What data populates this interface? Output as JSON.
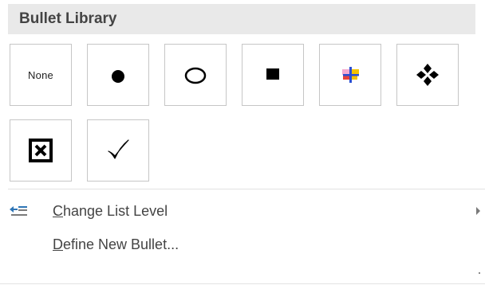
{
  "bullet_library": {
    "header": "Bullet Library",
    "tiles": [
      {
        "kind": "none",
        "label": "None"
      },
      {
        "kind": "filled-circle",
        "icon": "filled-circle-bullet-icon"
      },
      {
        "kind": "hollow-circle",
        "icon": "hollow-circle-bullet-icon"
      },
      {
        "kind": "filled-square",
        "icon": "filled-square-bullet-icon"
      },
      {
        "kind": "colored-cross",
        "icon": "colored-cross-bullet-icon",
        "colors": [
          "#e8423c",
          "#f5a9d0",
          "#f2c200",
          "#2a4fd4"
        ]
      },
      {
        "kind": "four-diamonds",
        "icon": "four-diamonds-bullet-icon"
      },
      {
        "kind": "x-box",
        "icon": "x-box-bullet-icon"
      },
      {
        "kind": "checkmark",
        "icon": "checkmark-bullet-icon"
      }
    ]
  },
  "menu": {
    "change_level": {
      "accel": "C",
      "rest": "hange List Level",
      "icon": "change-list-level-icon",
      "icon_color": "#2e75b6"
    },
    "define_new": {
      "accel": "D",
      "rest": "efine New Bullet..."
    }
  }
}
